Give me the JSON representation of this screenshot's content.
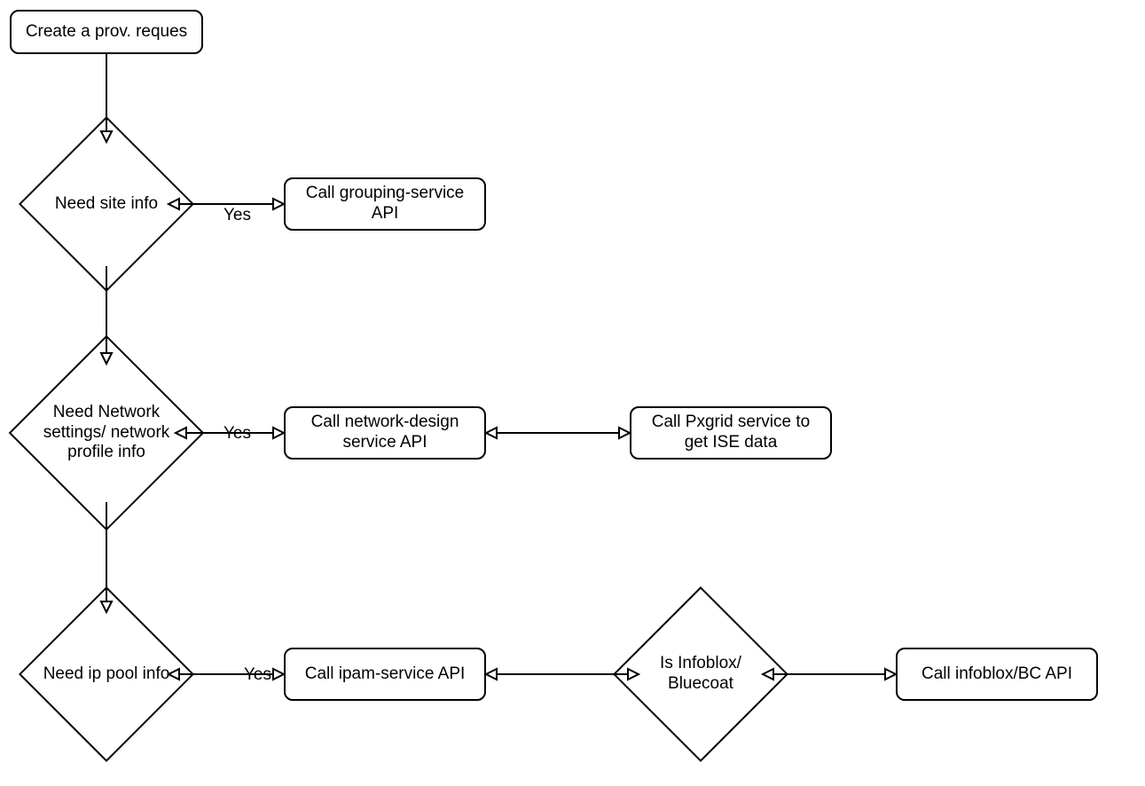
{
  "nodes": {
    "start": "Create a prov. reques",
    "need_site": "Need site info",
    "call_grouping": "Call grouping-service API",
    "need_network": "Need Network settings/ network profile info",
    "call_netdesign": "Call network-design service API",
    "call_pxgrid": "Call Pxgrid service to get ISE data",
    "need_ippool": "Need ip pool info",
    "call_ipam": "Call ipam-service API",
    "is_infoblox": "Is Infoblox/ Bluecoat",
    "call_infoblox": "Call infoblox/BC API"
  },
  "edge_labels": {
    "yes1": "Yes",
    "yes2": "Yes",
    "yes3": "Yes"
  }
}
